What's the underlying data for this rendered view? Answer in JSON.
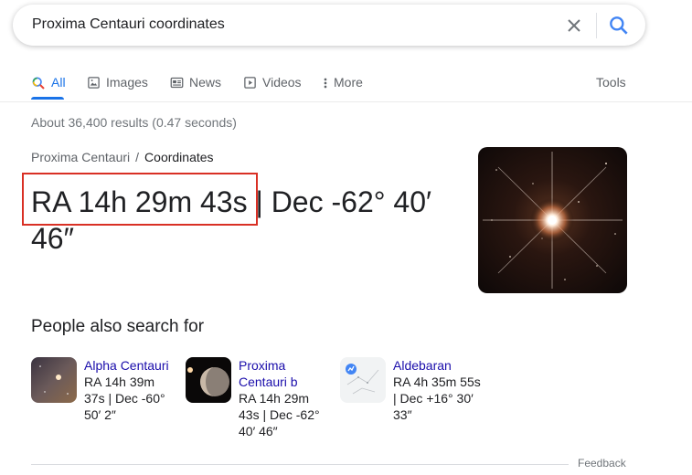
{
  "search": {
    "query": "Proxima Centauri coordinates"
  },
  "tabs": [
    {
      "label": "All",
      "icon": "search-icon",
      "active": true
    },
    {
      "label": "Images",
      "icon": "image-icon"
    },
    {
      "label": "News",
      "icon": "news-icon"
    },
    {
      "label": "Videos",
      "icon": "play-icon"
    },
    {
      "label": "More",
      "icon": "more-vert-icon"
    }
  ],
  "tools_label": "Tools",
  "result_stats": "About 36,400 results (0.47 seconds)",
  "breadcrumb": {
    "parent": "Proxima Centauri",
    "separator": "/",
    "current": "Coordinates"
  },
  "answer": {
    "ra": "RA 14h 29m 43s",
    "rest": " | Dec -62° 40′ 46″"
  },
  "people_also_search": {
    "title": "People also search for",
    "items": [
      {
        "name": "Alpha Centauri",
        "desc": "RA 14h 39m 37s | Dec -60° 50′ 2″"
      },
      {
        "name": "Proxima Centauri b",
        "desc": "RA 14h 29m 43s | Dec -62° 40′ 46″"
      },
      {
        "name": "Aldebaran",
        "desc": "RA 4h 35m 55s | Dec +16° 30′ 33″"
      }
    ]
  },
  "feedback_label": "Feedback",
  "colors": {
    "accent": "#1a73e8",
    "link": "#1a0dab",
    "highlight": "#d93025"
  }
}
